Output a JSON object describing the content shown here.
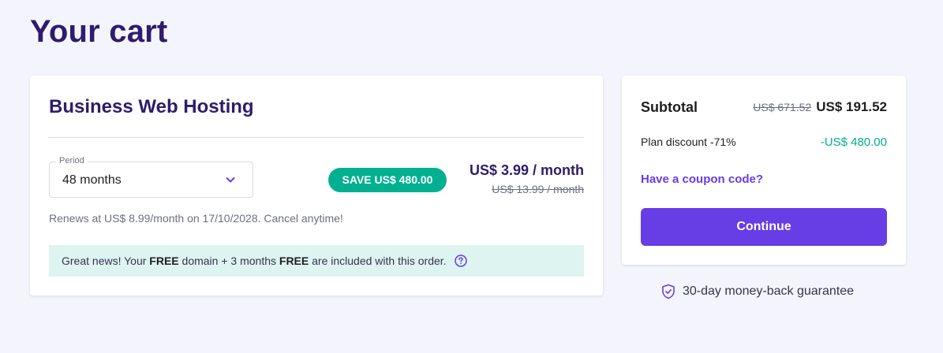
{
  "page": {
    "title": "Your cart"
  },
  "product": {
    "name": "Business Web Hosting",
    "period_label": "Period",
    "period_value": "48 months",
    "save_badge": "SAVE US$ 480.00",
    "price": "US$ 3.99 / month",
    "old_price": "US$ 13.99 / month",
    "renew_text": "Renews at US$ 8.99/month on 17/10/2028. Cancel anytime!",
    "promo": {
      "part1": "Great news! Your ",
      "bold1": "FREE",
      "part2": " domain + 3 months ",
      "bold2": "FREE",
      "part3": " are included with this order."
    }
  },
  "summary": {
    "subtotal_label": "Subtotal",
    "subtotal_old": "US$ 671.52",
    "subtotal_new": "US$ 191.52",
    "discount_label": "Plan discount -71%",
    "discount_value": "-US$ 480.00",
    "coupon_link": "Have a coupon code?",
    "continue_label": "Continue"
  },
  "guarantee": {
    "text": "30-day money-back guarantee"
  },
  "icons": {
    "chevron": "chevron-down-icon",
    "help": "question-circle-icon",
    "shield": "shield-check-icon"
  },
  "colors": {
    "primary": "#673de6",
    "title": "#2f1c6a",
    "success": "#00b090",
    "promo_bg": "#def4f0",
    "page_bg": "#f4f4fd"
  }
}
